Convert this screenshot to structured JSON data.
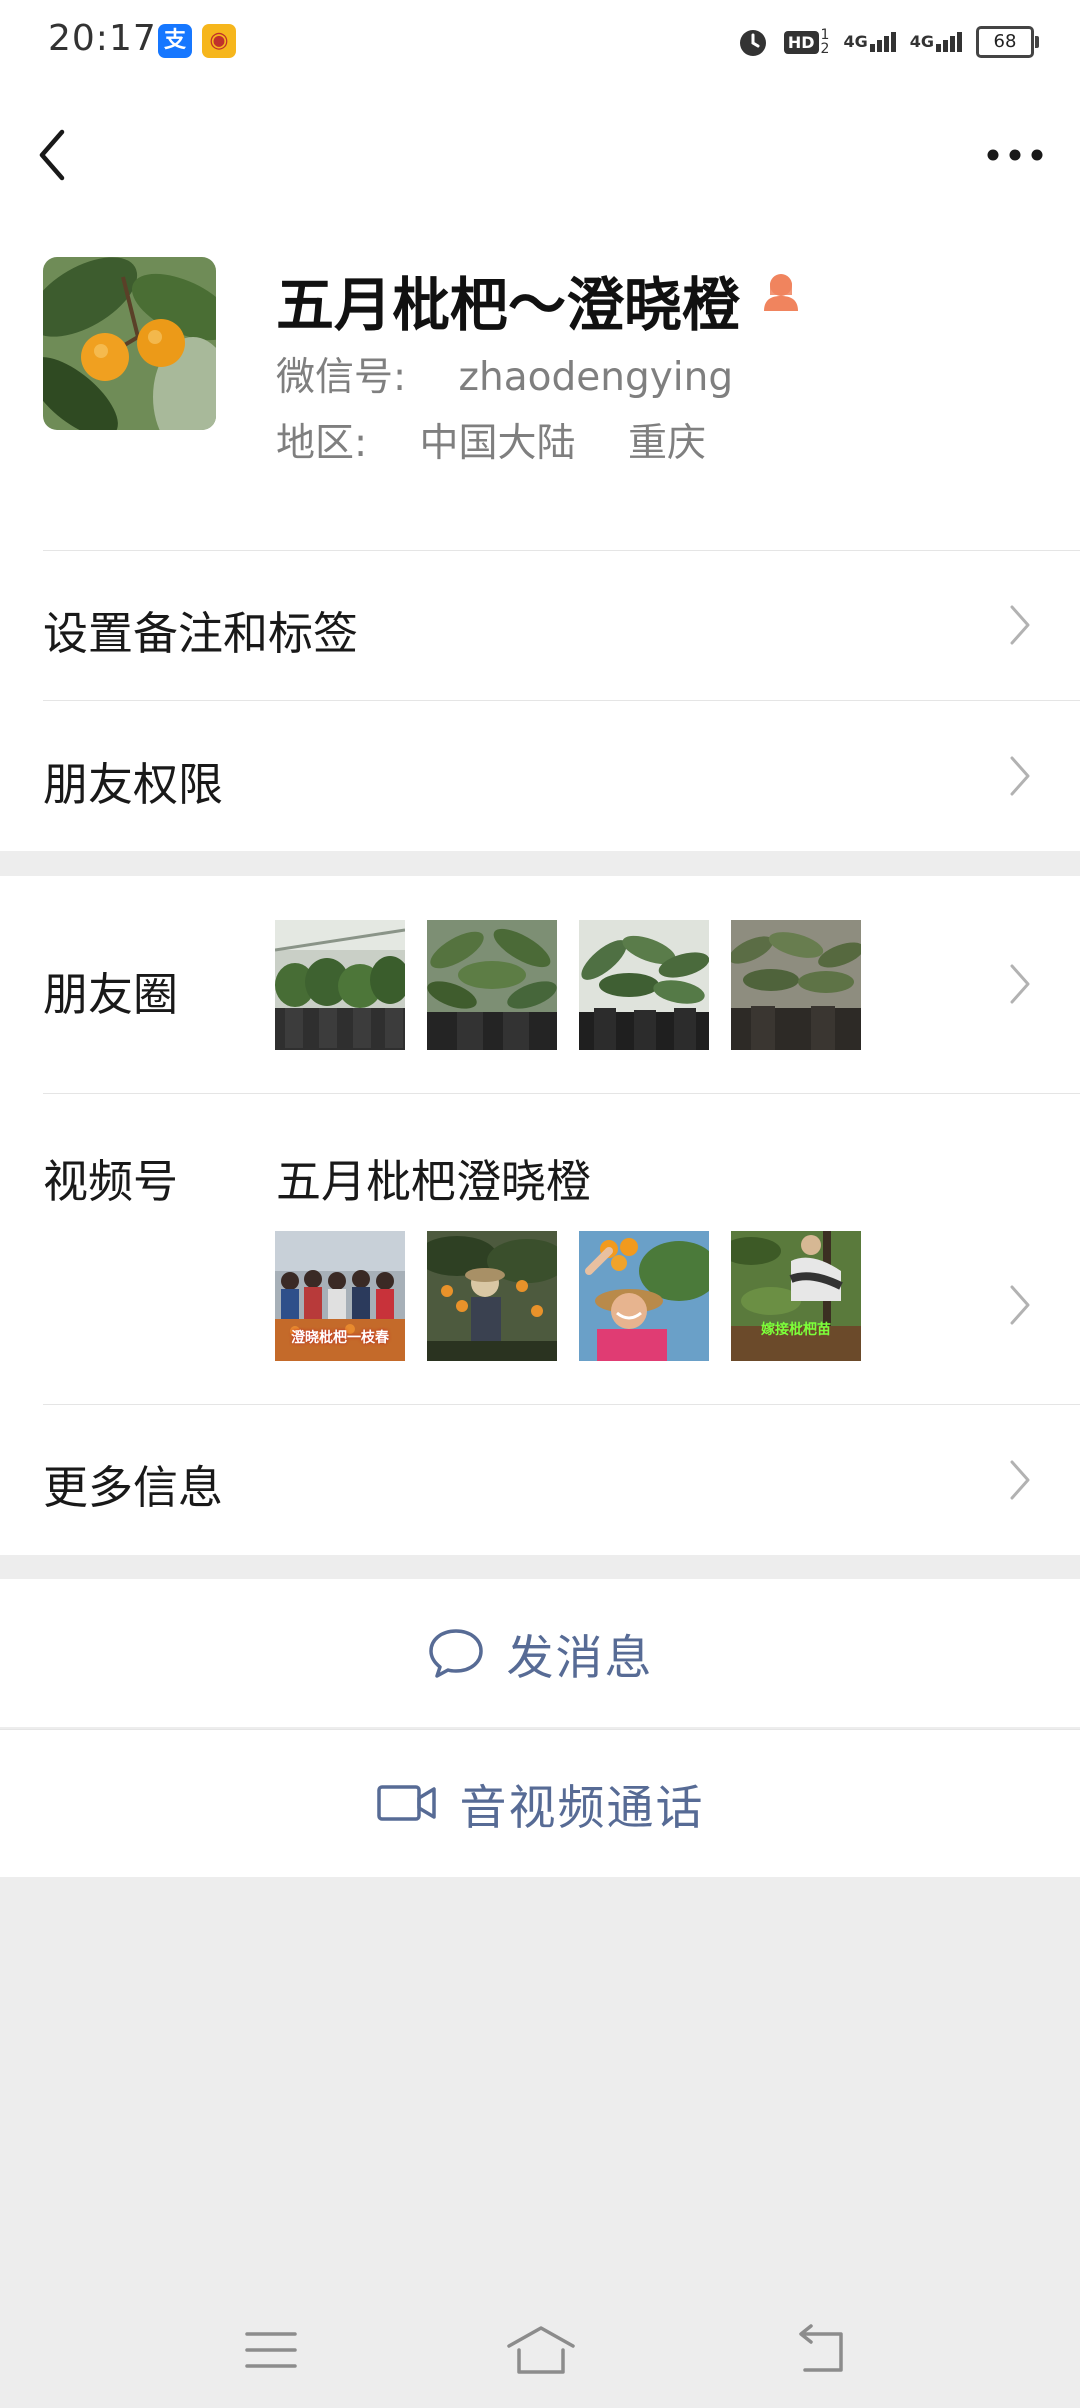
{
  "status_bar": {
    "time": "20:17",
    "battery": "68",
    "icons": [
      "alipay-icon",
      "app-badge-icon",
      "alarm-icon",
      "hd-icon",
      "signal-4g-icon",
      "signal-4g-icon",
      "battery-icon"
    ],
    "network_1": "4G",
    "network_2": "4G",
    "hd": "HD"
  },
  "navigation": {
    "back_icon": "chevron-left-icon",
    "more_icon": "more-dots-icon"
  },
  "profile": {
    "name": "五月枇杷～澄晓橙",
    "gender_icon": "female-person-icon",
    "wechat_id_label": "微信号:",
    "wechat_id": "zhaodengying",
    "region_label": "地区:",
    "region_country": "中国大陆",
    "region_city": "重庆"
  },
  "rows": {
    "remark_tags": "设置备注和标签",
    "friend_permissions": "朋友权限",
    "moments": "朋友圈",
    "channels": "视频号",
    "channels_name": "五月枇杷澄晓橙",
    "more_info": "更多信息"
  },
  "moments_thumbnails": [
    "loquat seedlings in pots",
    "loquat seedlings in pots",
    "loquat seedlings in pots",
    "loquat seedlings in pots"
  ],
  "channel_thumbnails": [
    {
      "caption": "澄晓枇杷一枝春"
    },
    {
      "caption": ""
    },
    {
      "caption": ""
    },
    {
      "caption": "嫁接枇杷苗"
    }
  ],
  "actions": {
    "send_message": "发消息",
    "video_call": "音视频通话"
  },
  "colors": {
    "link_blue": "#576b95",
    "background": "#ededed",
    "gender_female": "#f0845e"
  }
}
